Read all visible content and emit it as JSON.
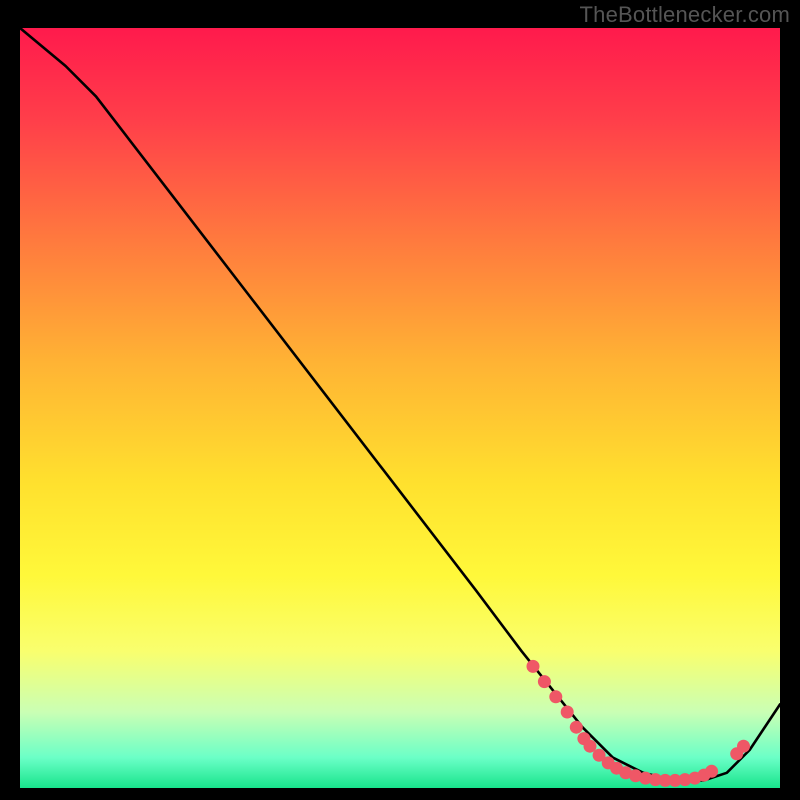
{
  "attribution": "TheBottlenecker.com",
  "chart_data": {
    "type": "line",
    "title": "",
    "xlabel": "",
    "ylabel": "",
    "xlim": [
      0,
      100
    ],
    "ylim": [
      0,
      100
    ],
    "series": [
      {
        "name": "bottleneck-curve",
        "x": [
          0,
          6,
          10,
          20,
          30,
          40,
          50,
          60,
          66,
          70,
          74,
          78,
          82,
          86,
          90,
          93,
          96,
          100
        ],
        "y": [
          100,
          95,
          91,
          78,
          65,
          52,
          39,
          26,
          18,
          13,
          8,
          4,
          2,
          1,
          1,
          2,
          5,
          11
        ]
      }
    ],
    "markers": {
      "name": "highlight-dots",
      "color": "#ef5766",
      "points": [
        {
          "x": 67.5,
          "y": 16
        },
        {
          "x": 69.0,
          "y": 14
        },
        {
          "x": 70.5,
          "y": 12
        },
        {
          "x": 72.0,
          "y": 10
        },
        {
          "x": 73.2,
          "y": 8
        },
        {
          "x": 74.2,
          "y": 6.5
        },
        {
          "x": 75.0,
          "y": 5.5
        },
        {
          "x": 76.2,
          "y": 4.3
        },
        {
          "x": 77.4,
          "y": 3.3
        },
        {
          "x": 78.5,
          "y": 2.6
        },
        {
          "x": 79.7,
          "y": 2.0
        },
        {
          "x": 81.0,
          "y": 1.6
        },
        {
          "x": 82.3,
          "y": 1.3
        },
        {
          "x": 83.6,
          "y": 1.1
        },
        {
          "x": 84.9,
          "y": 1.0
        },
        {
          "x": 86.2,
          "y": 1.0
        },
        {
          "x": 87.5,
          "y": 1.1
        },
        {
          "x": 88.8,
          "y": 1.3
        },
        {
          "x": 90.0,
          "y": 1.7
        },
        {
          "x": 91.0,
          "y": 2.2
        },
        {
          "x": 94.3,
          "y": 4.5
        },
        {
          "x": 95.2,
          "y": 5.5
        }
      ]
    }
  }
}
